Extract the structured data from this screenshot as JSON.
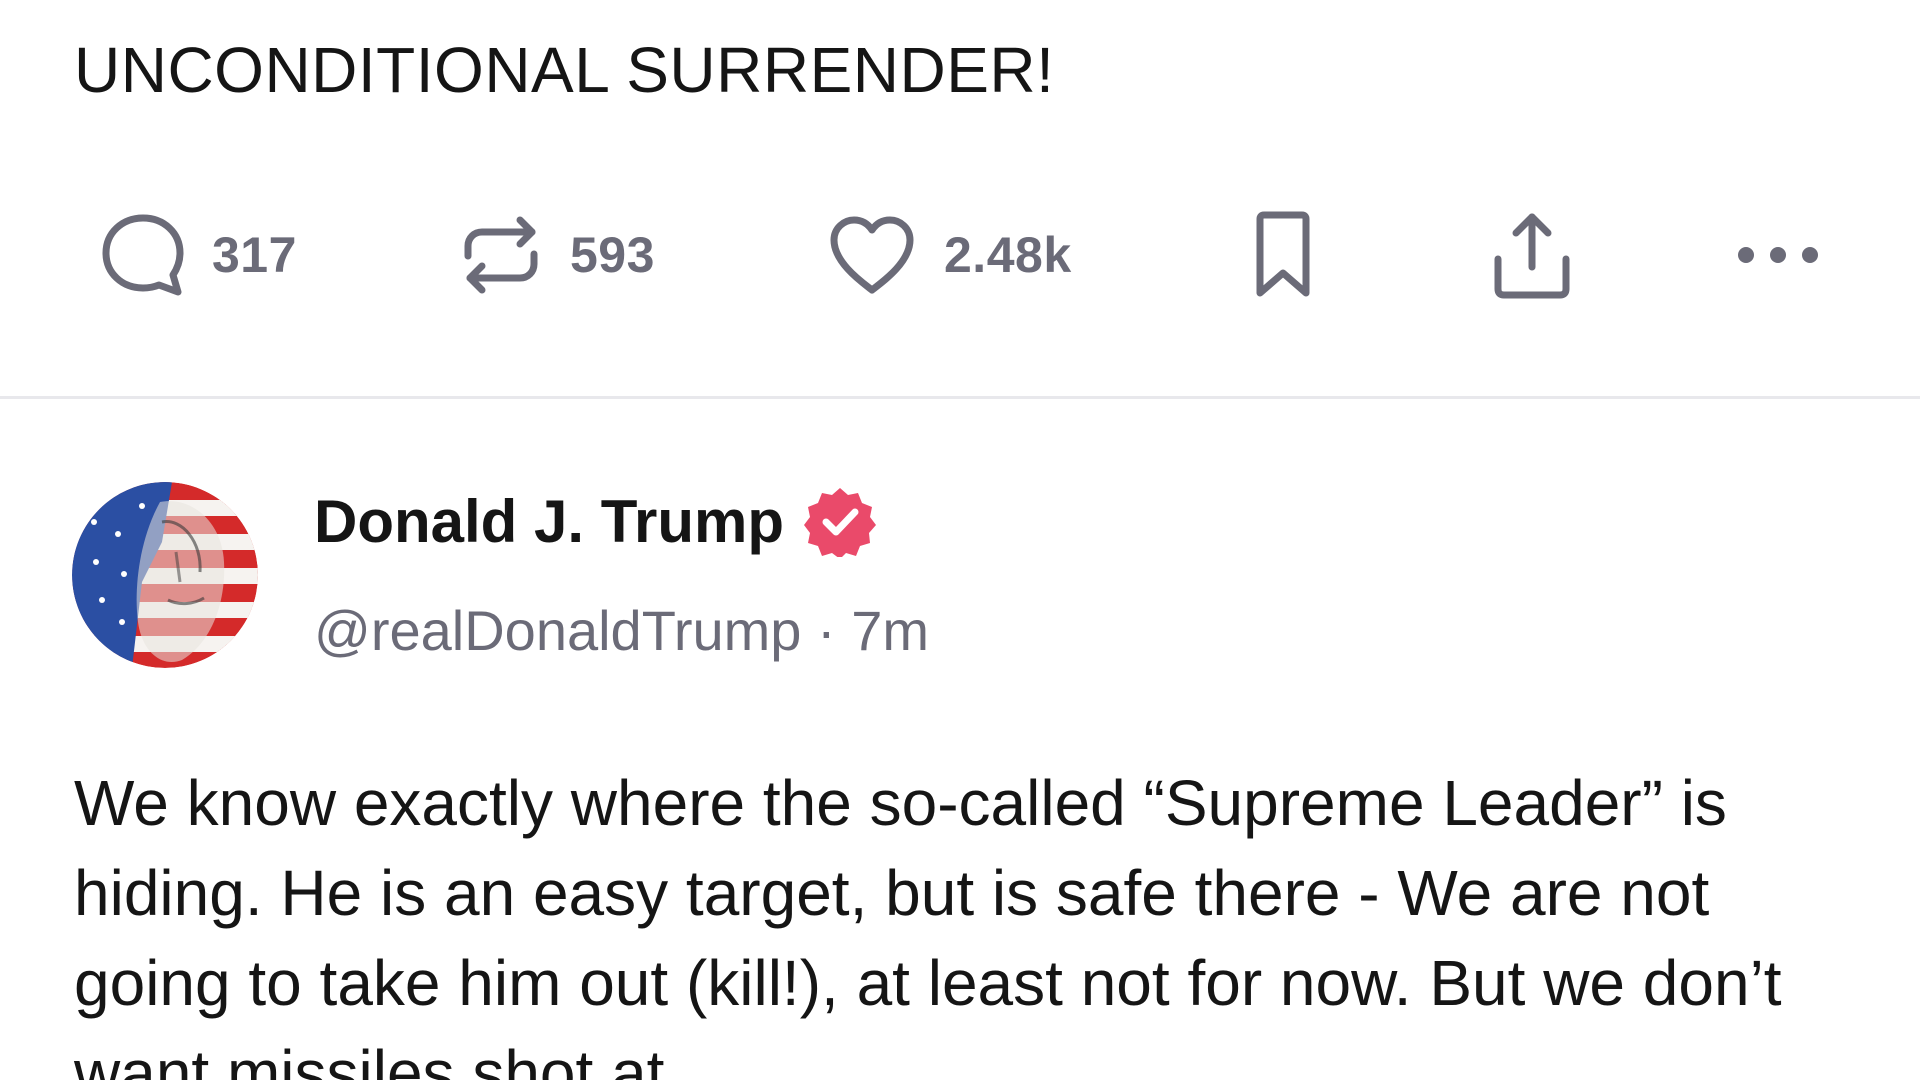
{
  "previous_post": {
    "text": "UNCONDITIONAL SURRENDER!",
    "actions": {
      "replies": "317",
      "reposts": "593",
      "likes": "2.48k"
    }
  },
  "post": {
    "author_name": "Donald J. Trump",
    "handle": "@realDonaldTrump",
    "separator": "·",
    "time": "7m",
    "body": "We know exactly where the so-called “Supreme Leader” is hiding. He is an easy target, but is safe there - We are not going to take him out (kill!), at least not for now. But we don’t want missiles shot at"
  },
  "icons": {
    "reply": "speech-bubble-icon",
    "repost": "repost-arrows-icon",
    "like": "heart-icon",
    "bookmark": "bookmark-icon",
    "share": "share-upload-icon",
    "more": "more-dots-icon",
    "verified": "verified-badge-icon"
  },
  "colors": {
    "icon_gray": "#6b6b78",
    "verified_badge": "#ea4a6a",
    "divider": "#e8e8ec"
  }
}
